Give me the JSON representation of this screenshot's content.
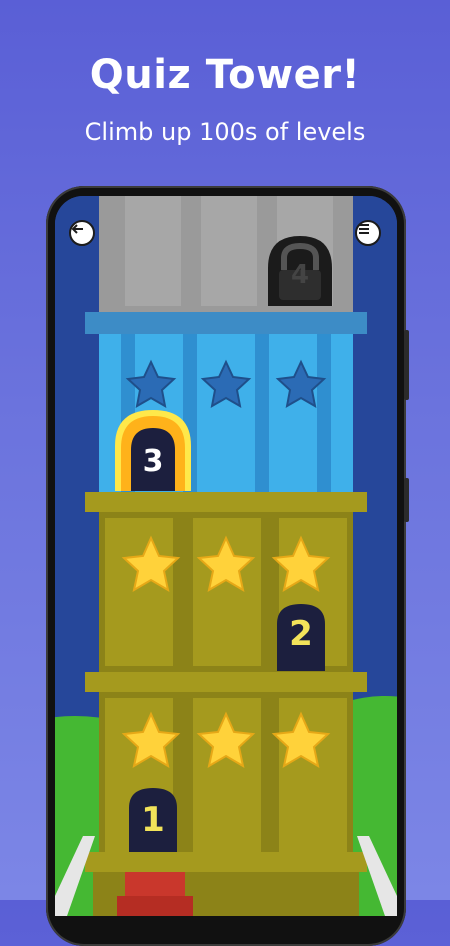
{
  "header": {
    "title": "Quiz Tower!",
    "subtitle": "Climb up 100s of levels"
  },
  "game": {
    "nav": {
      "back_icon": "arrow-left-icon",
      "menu_icon": "menu-icon"
    },
    "levels": [
      {
        "number": "1",
        "state": "unlocked",
        "stars_earned": 3,
        "stars_total": 3
      },
      {
        "number": "2",
        "state": "unlocked",
        "stars_earned": 3,
        "stars_total": 3
      },
      {
        "number": "3",
        "state": "current",
        "stars_earned": 0,
        "stars_total": 3
      },
      {
        "number": "4",
        "state": "locked",
        "stars_earned": 0,
        "stars_total": 0
      }
    ],
    "colors": {
      "gold_floor": "#a59a1e",
      "blue_floor": "#3fb0ea",
      "grey_floor": "#9a9a9a",
      "star_gold": "#ffd23a",
      "star_empty": "#2b6bb5",
      "door": "#1c1f3e",
      "highlight": "#ffb21a"
    }
  }
}
